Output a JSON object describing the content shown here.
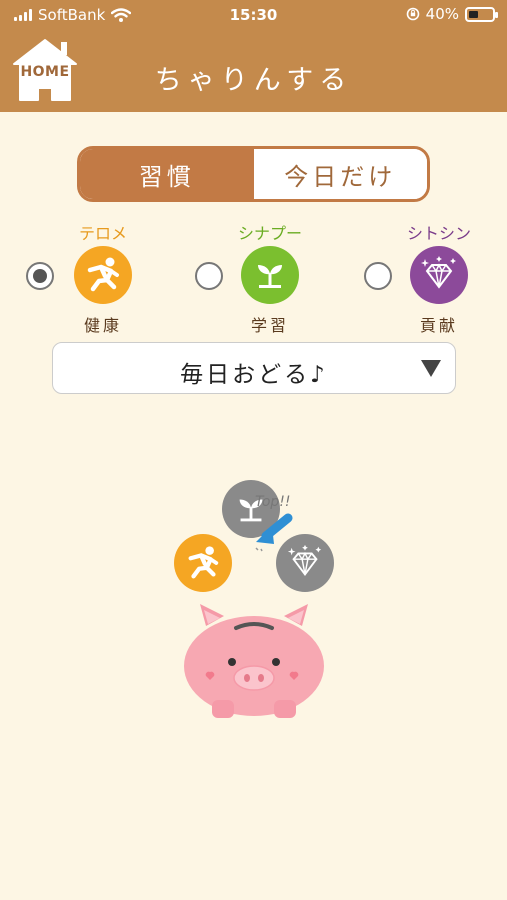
{
  "status_bar": {
    "carrier": "SoftBank",
    "time": "15:30",
    "battery": "40%",
    "battery_level": 0.4
  },
  "header": {
    "home_label": "HOME",
    "title": "ちゃりんする"
  },
  "tabs": [
    {
      "label": "習慣",
      "active": true
    },
    {
      "label": "今日だけ",
      "active": false
    }
  ],
  "categories": [
    {
      "name": "テロメ",
      "sub": "健康",
      "icon": "running-person-icon",
      "color": "#f5a623",
      "name_color": "#e79a1e",
      "selected": true
    },
    {
      "name": "シナプー",
      "sub": "学習",
      "icon": "sprout-icon",
      "color": "#7bbf2f",
      "name_color": "#6aac22",
      "selected": false
    },
    {
      "name": "シトシン",
      "sub": "貢献",
      "icon": "diamond-icon",
      "color": "#8c4a9a",
      "name_color": "#7a3b8a",
      "selected": false
    }
  ],
  "habit_select": {
    "value": "毎日おどる♪"
  },
  "scene": {
    "top_label": "Top!!",
    "coins": [
      {
        "icon": "sprout-icon",
        "color": "#8a8a8a"
      },
      {
        "icon": "running-person-icon",
        "color": "#f5a623"
      },
      {
        "icon": "diamond-icon",
        "color": "#8a8a8a"
      }
    ],
    "pig_color": "#f7a8b2"
  }
}
